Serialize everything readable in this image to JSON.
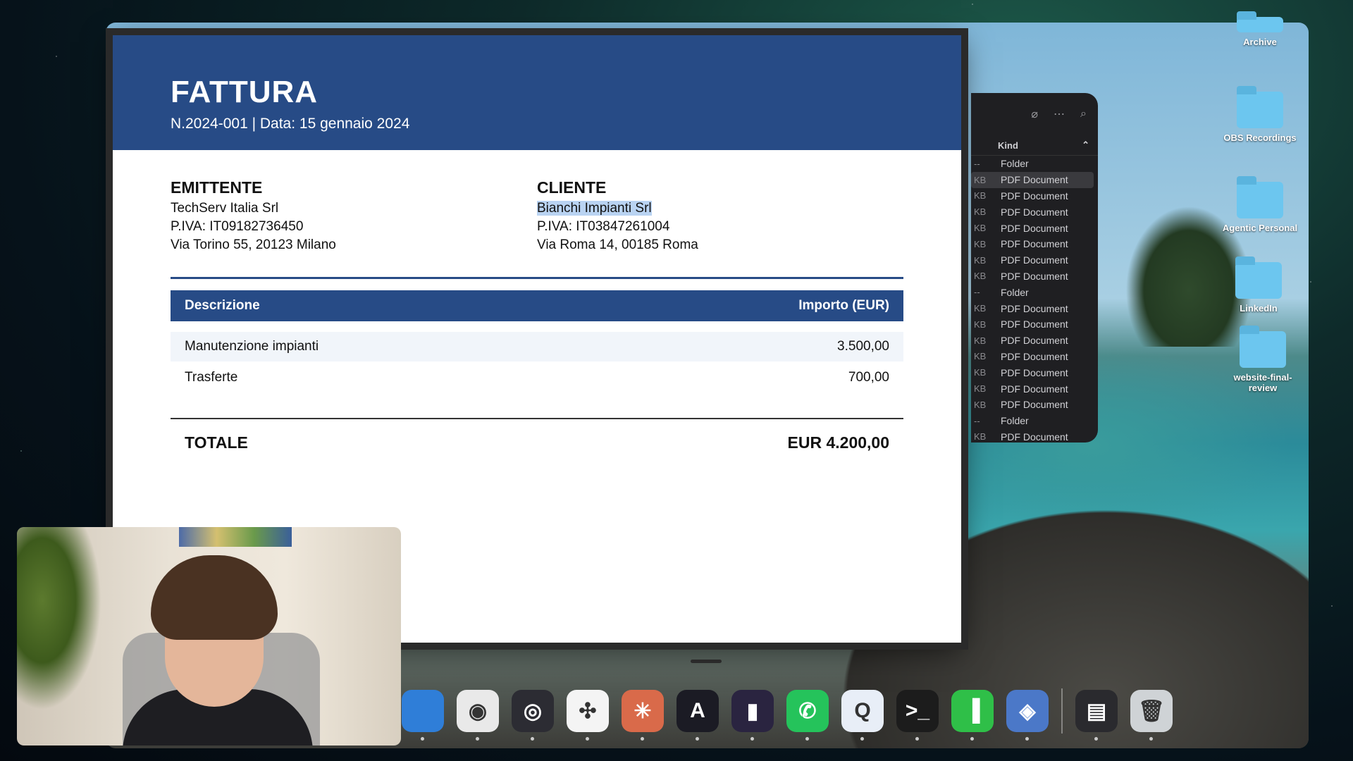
{
  "invoice": {
    "title": "FATTURA",
    "meta": "N.2024-001  |  Data: 15 gennaio 2024",
    "issuer": {
      "heading": "EMITTENTE",
      "name": "TechServ Italia Srl",
      "vat": "P.IVA: IT09182736450",
      "address": "Via Torino 55, 20123 Milano"
    },
    "client": {
      "heading": "CLIENTE",
      "name": "Bianchi Impianti Srl",
      "vat": "P.IVA: IT03847261004",
      "address": "Via Roma 14, 00185 Roma"
    },
    "table": {
      "col_description": "Descrizione",
      "col_amount": "Importo (EUR)",
      "rows": [
        {
          "description": "Manutenzione impianti",
          "amount": "3.500,00"
        },
        {
          "description": "Trasferte",
          "amount": "700,00"
        }
      ]
    },
    "total_label": "TOTALE",
    "total_value": "EUR 4.200,00"
  },
  "finder": {
    "column_header": "Kind",
    "rows": [
      {
        "size": "--",
        "kind": "Folder"
      },
      {
        "size": "KB",
        "kind": "PDF Document"
      },
      {
        "size": "KB",
        "kind": "PDF Document"
      },
      {
        "size": "KB",
        "kind": "PDF Document"
      },
      {
        "size": "KB",
        "kind": "PDF Document"
      },
      {
        "size": "KB",
        "kind": "PDF Document"
      },
      {
        "size": "KB",
        "kind": "PDF Document"
      },
      {
        "size": "KB",
        "kind": "PDF Document"
      },
      {
        "size": "--",
        "kind": "Folder"
      },
      {
        "size": "KB",
        "kind": "PDF Document"
      },
      {
        "size": "KB",
        "kind": "PDF Document"
      },
      {
        "size": "KB",
        "kind": "PDF Document"
      },
      {
        "size": "KB",
        "kind": "PDF Document"
      },
      {
        "size": "KB",
        "kind": "PDF Document"
      },
      {
        "size": "KB",
        "kind": "PDF Document"
      },
      {
        "size": "KB",
        "kind": "PDF Document"
      },
      {
        "size": "--",
        "kind": "Folder"
      },
      {
        "size": "KB",
        "kind": "PDF Document"
      }
    ]
  },
  "desktop_icons": [
    "Archive",
    "OBS Recordings",
    "Agentic Personal",
    "LinkedIn",
    "website-final-review"
  ],
  "dock": {
    "apps": [
      {
        "name": "finder-app-icon",
        "glyph": "",
        "color": "#2f7ed8"
      },
      {
        "name": "chrome-app-icon",
        "glyph": "◉",
        "color": "#e9e9e9"
      },
      {
        "name": "obs-app-icon",
        "glyph": "◎",
        "color": "#2c2c33"
      },
      {
        "name": "slack-app-icon",
        "glyph": "✣",
        "color": "#f4f4f4"
      },
      {
        "name": "claude-app-icon",
        "glyph": "✳",
        "color": "#d96a4a"
      },
      {
        "name": "arc-app-icon",
        "glyph": "A",
        "color": "#1b1b24"
      },
      {
        "name": "audio-app-icon",
        "glyph": "▮",
        "color": "#2a2440"
      },
      {
        "name": "whatsapp-app-icon",
        "glyph": "✆",
        "color": "#25c35b"
      },
      {
        "name": "quicktime-app-icon",
        "glyph": "Q",
        "color": "#e8eef7"
      },
      {
        "name": "terminal-app-icon",
        "glyph": ">_",
        "color": "#1c1c1c"
      },
      {
        "name": "numbers-app-icon",
        "glyph": "▐",
        "color": "#2fbf48"
      },
      {
        "name": "preview-app-icon",
        "glyph": "◈",
        "color": "#4b78c8"
      }
    ],
    "recent": [
      {
        "name": "recent-window-thumbnail-icon",
        "glyph": "▤",
        "color": "#2a2a2e"
      },
      {
        "name": "trash-icon",
        "glyph": "🗑",
        "color": "#cfd3d6"
      }
    ]
  }
}
